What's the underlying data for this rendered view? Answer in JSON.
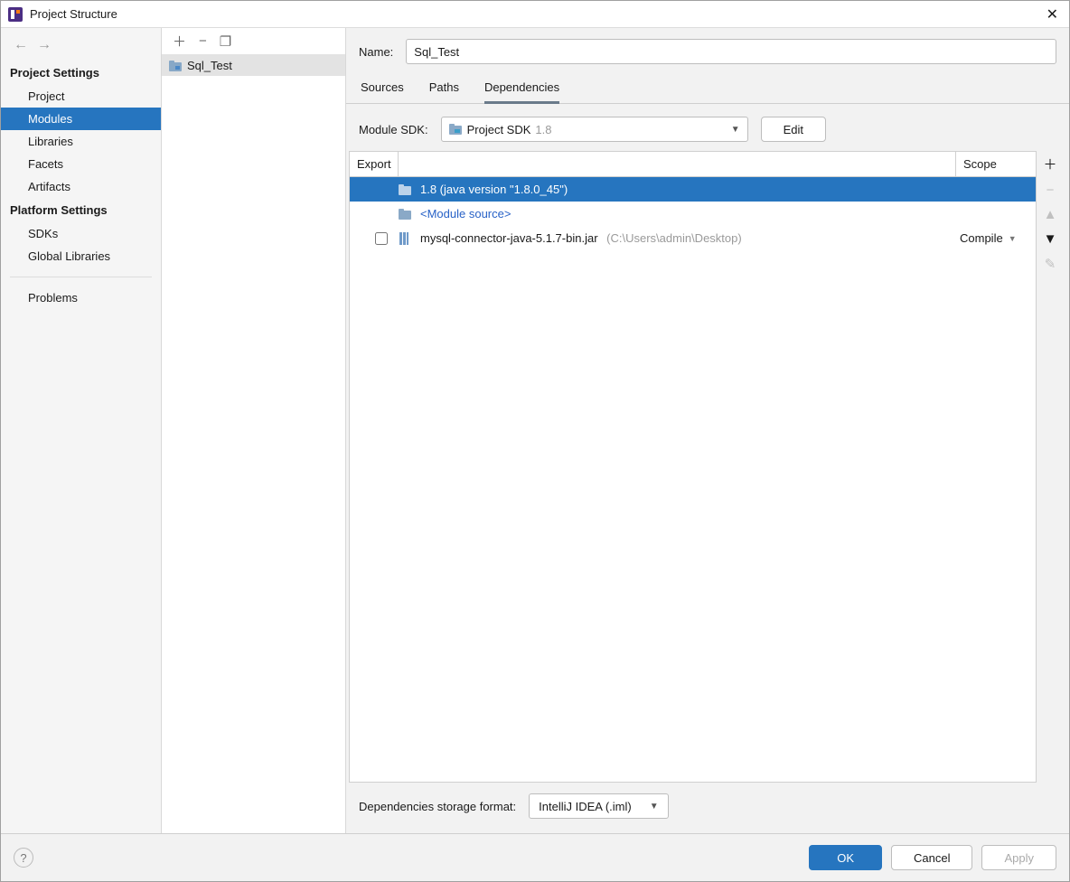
{
  "window_title": "Project Structure",
  "sidebar": {
    "sections": [
      {
        "title": "Project Settings",
        "items": [
          "Project",
          "Modules",
          "Libraries",
          "Facets",
          "Artifacts"
        ],
        "selected_index": 1
      },
      {
        "title": "Platform Settings",
        "items": [
          "SDKs",
          "Global Libraries"
        ]
      }
    ],
    "problems": "Problems"
  },
  "tree": {
    "module_name": "Sql_Test"
  },
  "name_label": "Name:",
  "name_value": "Sql_Test",
  "tabs": [
    "Sources",
    "Paths",
    "Dependencies"
  ],
  "active_tab_index": 2,
  "sdk": {
    "label": "Module SDK:",
    "value": "Project SDK",
    "version": "1.8",
    "edit": "Edit"
  },
  "dep_header": {
    "export": "Export",
    "scope": "Scope"
  },
  "dep_rows": [
    {
      "type": "sdk",
      "selected": true,
      "label": "1.8 (java version \"1.8.0_45\")"
    },
    {
      "type": "source",
      "label": "<Module source>"
    },
    {
      "type": "jar",
      "checked": false,
      "label": "mysql-connector-java-5.1.7-bin.jar",
      "path": "(C:\\Users\\admin\\Desktop)",
      "scope": "Compile"
    }
  ],
  "storage": {
    "label": "Dependencies storage format:",
    "value": "IntelliJ IDEA (.iml)"
  },
  "footer": {
    "ok": "OK",
    "cancel": "Cancel",
    "apply": "Apply"
  }
}
